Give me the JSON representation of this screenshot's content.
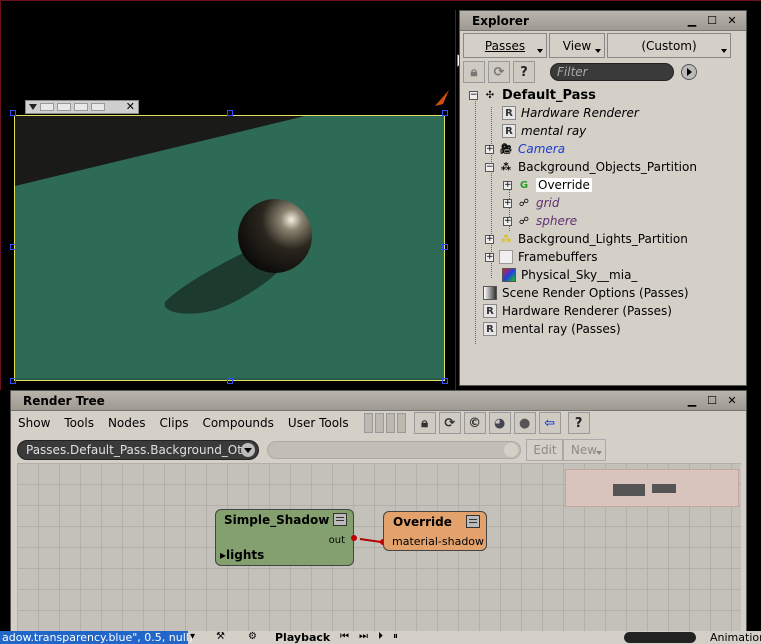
{
  "explorer": {
    "title": "Explorer",
    "toolbar": {
      "passes_label": "Passes",
      "view_label": "View",
      "custom_label": "(Custom)"
    },
    "filter_placeholder": "Filter",
    "tree": [
      {
        "label": "Default_Pass",
        "style": "bold",
        "icon": "pass-icon"
      },
      {
        "label": "Hardware Renderer",
        "style": "italic",
        "icon": "renderer-icon"
      },
      {
        "label": "mental ray",
        "style": "italic",
        "icon": "renderer-icon"
      },
      {
        "label": "Camera",
        "style": "blue",
        "icon": "camera-icon"
      },
      {
        "label": "Background_Objects_Partition",
        "style": "normal",
        "icon": "partition-icon"
      },
      {
        "label": "Override",
        "style": "selected",
        "icon": "override-icon"
      },
      {
        "label": "grid",
        "style": "purple",
        "icon": "object-icon"
      },
      {
        "label": "sphere",
        "style": "purple",
        "icon": "object-icon"
      },
      {
        "label": "Background_Lights_Partition",
        "style": "normal",
        "icon": "lights-partition-icon"
      },
      {
        "label": "Framebuffers",
        "style": "normal",
        "icon": "folder-icon"
      },
      {
        "label": "Physical_Sky__mia_",
        "style": "normal",
        "icon": "shader-icon"
      },
      {
        "label": "Scene Render Options (Passes)",
        "style": "normal",
        "icon": "render-options-icon"
      },
      {
        "label": "Hardware Renderer (Passes)",
        "style": "normal",
        "icon": "renderer-options-icon"
      },
      {
        "label": "mental ray (Passes)",
        "style": "normal",
        "icon": "renderer-options-icon"
      }
    ]
  },
  "render_tree": {
    "title": "Render Tree",
    "menu": [
      "Show",
      "Tools",
      "Nodes",
      "Clips",
      "Compounds",
      "User Tools"
    ],
    "path": "Passes.Default_Pass.Background_Ot",
    "edit_label": "Edit",
    "new_label": "New",
    "nodes": {
      "shadow": {
        "title": "Simple_Shadow",
        "out": "out",
        "input": "lights"
      },
      "override": {
        "title": "Override",
        "input": "material-shadow"
      }
    }
  },
  "bottom": {
    "script_line": "adow.transparency.blue\", 0.5, null)",
    "playback_label": "Playback",
    "animation_label": "Animation"
  },
  "colors": {
    "scene_floor": "#2e6b56",
    "shadow_node": "#83a06e",
    "override_node": "#e3a26c",
    "accent_selection": "#2166c8"
  }
}
